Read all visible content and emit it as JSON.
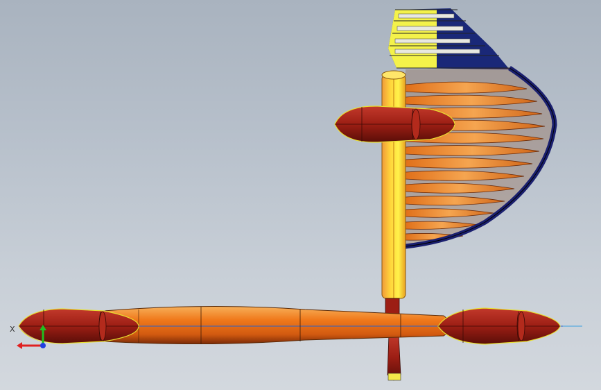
{
  "viewport": {
    "background_top": "#a9b3bf",
    "background_bottom": "#d3d8de"
  },
  "model": {
    "colors": {
      "hull_orange": "#f07a1c",
      "pod_red": "#9c1e14",
      "mast_yellow": "#ffe030",
      "sail_orange": "#f39a3a",
      "sail_edge_navy": "#1a1f6e",
      "highlight_yellow": "#f4f24a"
    }
  },
  "triad": {
    "x_label": "X",
    "x_color": "#e02020",
    "y_color": "#20c020",
    "z_color": "#2040e0"
  }
}
